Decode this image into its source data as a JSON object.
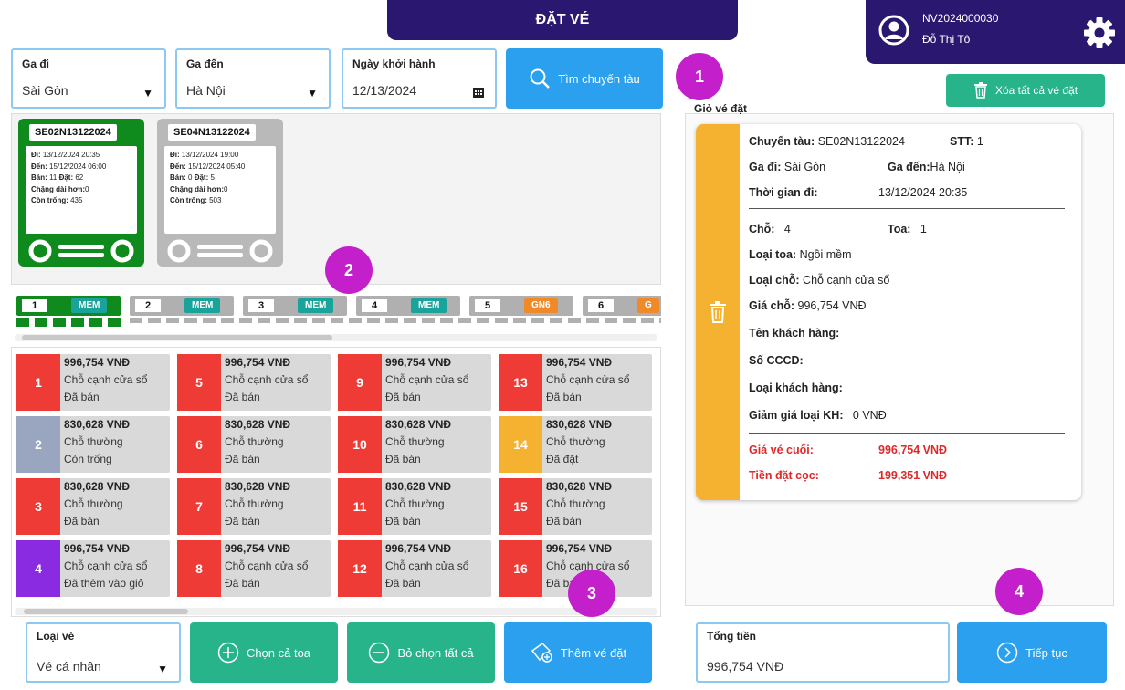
{
  "header": {
    "title": "ĐẶT VÉ"
  },
  "user": {
    "id": "NV2024000030",
    "name": "Đỗ Thị Tô"
  },
  "search": {
    "from": {
      "label": "Ga đi",
      "value": "Sài Gòn"
    },
    "to": {
      "label": "Ga đến",
      "value": "Hà Nội"
    },
    "date": {
      "label": "Ngày khởi hành",
      "value": "12/13/2024"
    },
    "button": "Tìm chuyến tàu"
  },
  "trains": [
    {
      "id": "SE02N13122024",
      "depart": "13/12/2024 20:35",
      "arrive": "15/12/2024 06:00",
      "sold": "11",
      "booked": "62",
      "longer": "0",
      "empty": "435",
      "color": "#0f8a1c"
    },
    {
      "id": "SE04N13122024",
      "depart": "13/12/2024 19:00",
      "arrive": "15/12/2024 05:40",
      "sold": "0",
      "booked": "5",
      "longer": "0",
      "empty": "503",
      "color": "#b9b9b9"
    }
  ],
  "train_labels": {
    "depart": "Đi:",
    "arrive": "Đến:",
    "sold": "Bán:",
    "booked": "Đặt:",
    "longer": "Chặng dài hơn:",
    "empty": "Còn trống:"
  },
  "carriages": [
    {
      "num": "1",
      "type": "MEM",
      "type_color": "#1aa39a",
      "color": "#0f8a1c"
    },
    {
      "num": "2",
      "type": "MEM",
      "type_color": "#1aa39a",
      "color": "#b0b0b0"
    },
    {
      "num": "3",
      "type": "MEM",
      "type_color": "#1aa39a",
      "color": "#b0b0b0"
    },
    {
      "num": "4",
      "type": "MEM",
      "type_color": "#1aa39a",
      "color": "#b0b0b0"
    },
    {
      "num": "5",
      "type": "GN6",
      "type_color": "#f08a28",
      "color": "#b0b0b0"
    },
    {
      "num": "6",
      "type": "G",
      "type_color": "#f08a28",
      "color": "#b0b0b0"
    }
  ],
  "seats": [
    {
      "num": "1",
      "price": "996,754 VNĐ",
      "type": "Chỗ cạnh cửa sổ",
      "status": "Đã bán",
      "color": "#ef3b36"
    },
    {
      "num": "5",
      "price": "996,754 VNĐ",
      "type": "Chỗ cạnh cửa sổ",
      "status": "Đã bán",
      "color": "#ef3b36"
    },
    {
      "num": "9",
      "price": "996,754 VNĐ",
      "type": "Chỗ cạnh cửa sổ",
      "status": "Đã bán",
      "color": "#ef3b36"
    },
    {
      "num": "13",
      "price": "996,754 VNĐ",
      "type": "Chỗ cạnh cửa sổ",
      "status": "Đã bán",
      "color": "#ef3b36"
    },
    {
      "num": "2",
      "price": "830,628 VNĐ",
      "type": "Chỗ thường",
      "status": "Còn trống",
      "color": "#9aa6bf"
    },
    {
      "num": "6",
      "price": "830,628 VNĐ",
      "type": "Chỗ thường",
      "status": "Đã bán",
      "color": "#ef3b36"
    },
    {
      "num": "10",
      "price": "830,628 VNĐ",
      "type": "Chỗ thường",
      "status": "Đã bán",
      "color": "#ef3b36"
    },
    {
      "num": "14",
      "price": "830,628 VNĐ",
      "type": "Chỗ thường",
      "status": "Đã đặt",
      "color": "#f5b230"
    },
    {
      "num": "3",
      "price": "830,628 VNĐ",
      "type": "Chỗ thường",
      "status": "Đã bán",
      "color": "#ef3b36"
    },
    {
      "num": "7",
      "price": "830,628 VNĐ",
      "type": "Chỗ thường",
      "status": "Đã bán",
      "color": "#ef3b36"
    },
    {
      "num": "11",
      "price": "830,628 VNĐ",
      "type": "Chỗ thường",
      "status": "Đã bán",
      "color": "#ef3b36"
    },
    {
      "num": "15",
      "price": "830,628 VNĐ",
      "type": "Chỗ thường",
      "status": "Đã bán",
      "color": "#ef3b36"
    },
    {
      "num": "4",
      "price": "996,754 VNĐ",
      "type": "Chỗ cạnh cửa sổ",
      "status": "Đã thêm vào giỏ",
      "color": "#8a2be2"
    },
    {
      "num": "8",
      "price": "996,754 VNĐ",
      "type": "Chỗ cạnh cửa sổ",
      "status": "Đã bán",
      "color": "#ef3b36"
    },
    {
      "num": "12",
      "price": "996,754 VNĐ",
      "type": "Chỗ cạnh cửa sổ",
      "status": "Đã bán",
      "color": "#ef3b36"
    },
    {
      "num": "16",
      "price": "996,754 VNĐ",
      "type": "Chỗ cạnh cửa sổ",
      "status": "Đã bán",
      "color": "#ef3b36"
    }
  ],
  "badges": [
    "1",
    "2",
    "3",
    "4"
  ],
  "cart": {
    "title": "Giỏ vé đặt",
    "clear_button": "Xóa tất cả vé đặt",
    "item": {
      "train_label": "Chuyến tàu:",
      "train": "SE02N13122024",
      "stt_label": "STT:",
      "stt": "1",
      "from_label": "Ga đi:",
      "from": "Sài Gòn",
      "to_label": "Ga đến:",
      "to": "Hà Nội",
      "time_label": "Thời gian đi:",
      "time": "13/12/2024 20:35",
      "seat_label": "Chỗ:",
      "seat": "4",
      "car_label": "Toa:",
      "car": "1",
      "car_type_label": "Loại toa:",
      "car_type": "Ngồi mềm",
      "seat_type_label": "Loại chỗ:",
      "seat_type": "Chỗ cạnh cửa sổ",
      "price_label": "Giá chỗ:",
      "price": "996,754 VNĐ",
      "customer_label": "Tên khách hàng:",
      "cccd_label": "Số CCCD:",
      "customer_type_label": "Loại khách hàng:",
      "discount_label": "Giảm giá loại KH:",
      "discount": "0 VNĐ",
      "final_label": "Giá vé cuối:",
      "final": "996,754 VNĐ",
      "deposit_label": "Tiền đặt cọc:",
      "deposit": "199,351 VNĐ"
    }
  },
  "bottom": {
    "ticket_type_label": "Loại vé",
    "ticket_type": "Vé cá nhân",
    "select_car": "Chọn cả toa",
    "deselect_all": "Bỏ chọn tất cả",
    "add_ticket": "Thêm vé đặt",
    "total_label": "Tổng tiền",
    "total": "996,754 VNĐ",
    "continue": "Tiếp tục"
  },
  "colors": {
    "navy": "#2a1870",
    "blue": "#2aa0ef",
    "teal": "#27b48a",
    "badge": "#c320cc"
  }
}
